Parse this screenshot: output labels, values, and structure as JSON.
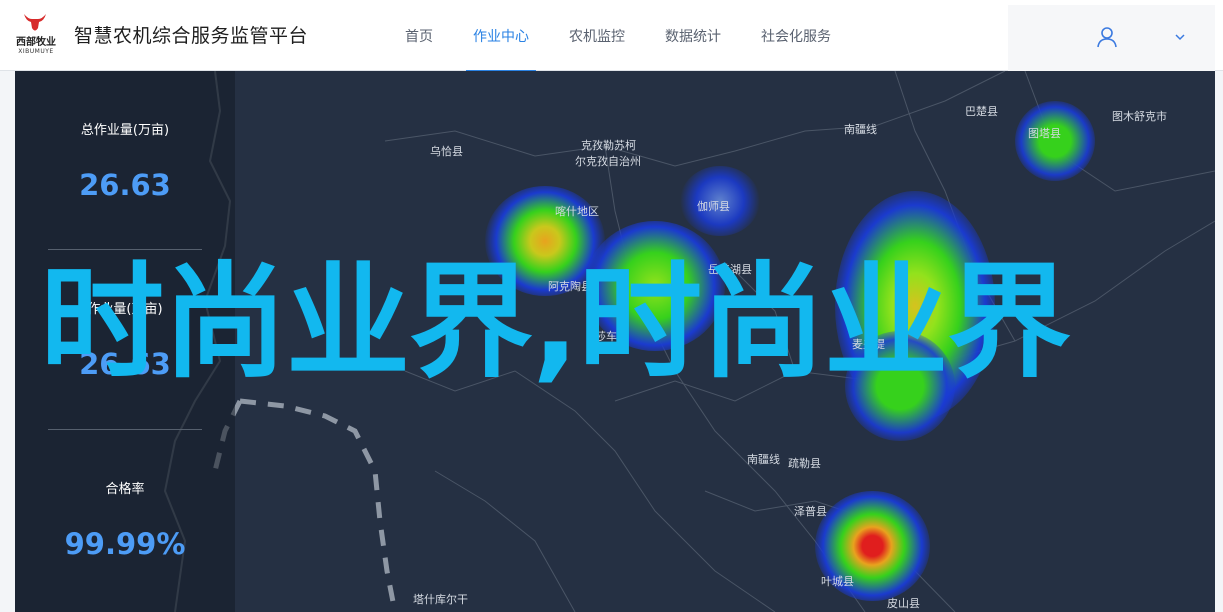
{
  "header": {
    "logo_text_cn": "西部牧业",
    "logo_text_en": "XIBUMUYE",
    "site_title": "智慧农机综合服务监管平台",
    "nav": [
      "首页",
      "作业中心",
      "农机监控",
      "数据统计",
      "社会化服务"
    ],
    "active_nav": "作业中心"
  },
  "user": {
    "icon": "user-icon",
    "dropdown_icon": "chevron-down-icon"
  },
  "stats": [
    {
      "label": "总作业量(万亩)",
      "value": "26.63"
    },
    {
      "label": "作业量(万亩)",
      "value": "26.63"
    },
    {
      "label": "合格率",
      "value": "99.99%"
    }
  ],
  "map": {
    "places": [
      "乌恰县",
      "克孜勒苏柯",
      "尔克孜自治州",
      "喀什地区",
      "伽师县",
      "岳普湖县",
      "阿克陶县",
      "莎车县",
      "麦盖提",
      "南疆线",
      "图木舒克市",
      "图塔县",
      "巴楚县",
      "南疆线",
      "疏勒县",
      "泽普县",
      "叶城县",
      "塔什库尔干",
      "皮山县"
    ],
    "colors": {
      "background": "#253043",
      "heat_low": "#1a3bd6",
      "heat_mid": "#36d11c",
      "heat_high": "#e8a31e",
      "heat_max": "#e01e1e"
    }
  },
  "overlay": {
    "text": "时尚业界,时尚业界",
    "color": "#12b8ef"
  }
}
